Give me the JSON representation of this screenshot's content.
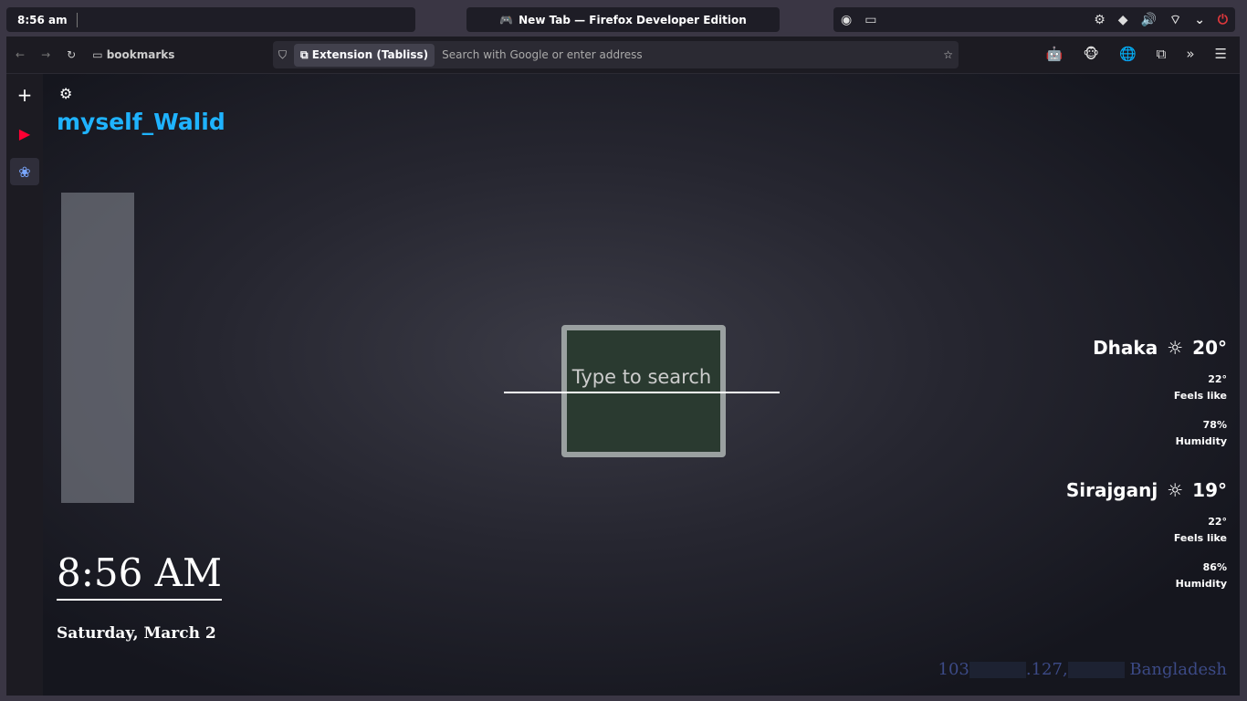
{
  "panel": {
    "clock": "8:56 am",
    "window_title": "New Tab — Firefox Developer Edition"
  },
  "toolbar": {
    "bookmarks": "bookmarks",
    "ext_chip": "Extension (Tabliss)",
    "address_placeholder": "Search with Google or enter address"
  },
  "page": {
    "greeting": "myself_Walid",
    "search_placeholder": "Type to search",
    "time": "8:56 AM",
    "date": "Saturday, March 2",
    "weather": [
      {
        "city": "Dhaka",
        "temp": "20°",
        "feels": "22°",
        "feels_label": "Feels like",
        "humidity": "78%",
        "humidity_label": "Humidity"
      },
      {
        "city": "Sirajganj",
        "temp": "19°",
        "feels": "22°",
        "feels_label": "Feels like",
        "humidity": "86%",
        "humidity_label": "Humidity"
      }
    ],
    "ip_prefix": "103",
    "ip_mid": ".127,",
    "country": "Bangladesh"
  },
  "colors": {
    "accent": "#1fb3ff",
    "power": "#e0383c"
  }
}
